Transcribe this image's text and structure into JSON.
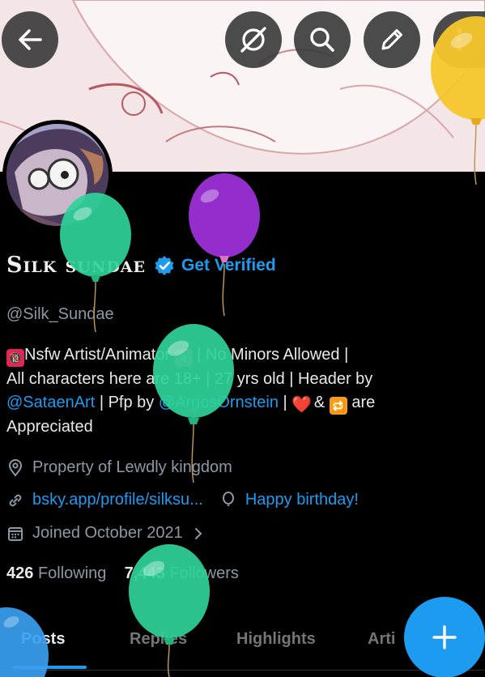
{
  "toolbar": {
    "back_icon": "arrow-left-icon",
    "grok_icon": "grok-icon",
    "search_icon": "search-icon",
    "edit_icon": "pencil-icon",
    "more_icon": "more-vertical-icon"
  },
  "profile": {
    "display_name": "Silk sundae",
    "get_verified": "Get Verified",
    "handle": "@Silk_Sundae",
    "bio": {
      "line1_prefix": "Nsfw Artist/Animator",
      "line1_suffix": "| No Minors Allowed |",
      "line2": "All characters here are 18+ | 27 yrs old | Header by",
      "line3_link1": "@SataenArt",
      "line3_mid": "| Pfp by",
      "line3_link2": "@ArgosOrnstein",
      "line3_sep": "|",
      "line3_amp": "&",
      "line3_end": "are",
      "line4": "Appreciated",
      "no_minors_emoji": "🔞",
      "heart_emoji": "❤️",
      "retweet_emoji": "🔁"
    },
    "location": "Property of Lewdly kingdom",
    "website": "bsky.app/profile/silksu...",
    "birthday": "Happy birthday!",
    "joined": "Joined October 2021",
    "following_count": "426",
    "following_label": "Following",
    "followers_count": "7,443",
    "followers_label": "Followers"
  },
  "tabs": [
    {
      "label": "Posts",
      "active": true
    },
    {
      "label": "Replies",
      "active": false
    },
    {
      "label": "Highlights",
      "active": false
    },
    {
      "label": "Arti",
      "active": false
    }
  ],
  "fab": {
    "icon": "plus-icon"
  },
  "colors": {
    "accent": "#1d9bf0",
    "background": "#000000",
    "muted_text": "#8b98a5",
    "balloon_green": "#2fd39a",
    "balloon_purple": "#9b2fd6",
    "balloon_yellow": "#f6c62c",
    "balloon_blue": "#3aa0f0"
  }
}
